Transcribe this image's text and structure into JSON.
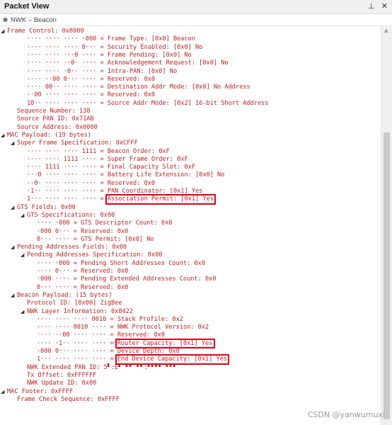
{
  "window": {
    "title": "Packet View",
    "pin_glyph": "1",
    "close_glyph": "✕",
    "subtab": "NWK – Beacon"
  },
  "tree": [
    {
      "indent": 0,
      "expander": "open",
      "text": "Frame Control: 0x8000"
    },
    {
      "indent": 2,
      "expander": "none",
      "text": "···· ···· ···· ·000 = Frame Type: [0x0] Beacon"
    },
    {
      "indent": 2,
      "expander": "none",
      "text": "···· ···· ···· 0··· = Security Enabled: [0x0] No"
    },
    {
      "indent": 2,
      "expander": "none",
      "text": "···· ···· ···0 ···· = Frame Pending: [0x0] No"
    },
    {
      "indent": 2,
      "expander": "none",
      "text": "···· ···· ··0· ···· = Acknowledgement Request: [0x0] No"
    },
    {
      "indent": 2,
      "expander": "none",
      "text": "···· ···· ·0·· ···· = Intra-PAN: [0x0] No"
    },
    {
      "indent": 2,
      "expander": "none",
      "text": "···· ··00 0··· ···· = Reserved: 0x0"
    },
    {
      "indent": 2,
      "expander": "none",
      "text": "···· 00·· ···· ···· = Destination Addr Mode: [0x0] No Address"
    },
    {
      "indent": 2,
      "expander": "none",
      "text": "··00 ···· ···· ···· = Reserved: 0x0"
    },
    {
      "indent": 2,
      "expander": "none",
      "text": "10·· ···· ···· ···· = Source Addr Mode: [0x2] 16-bit Short Address"
    },
    {
      "indent": 1,
      "expander": "none",
      "text": "Sequence Number: 138"
    },
    {
      "indent": 1,
      "expander": "none",
      "text": "Source PAN ID: 0x71AB"
    },
    {
      "indent": 1,
      "expander": "none",
      "text": "Source Address: 0x0000"
    },
    {
      "indent": 0,
      "expander": "open",
      "text": "MAC Payload: (19 bytes)"
    },
    {
      "indent": 1,
      "expander": "open",
      "text": "Super Frame Specification: 0xCFFF"
    },
    {
      "indent": 2,
      "expander": "none",
      "text": "···· ···· ···· 1111 = Beacon Order: 0xF"
    },
    {
      "indent": 2,
      "expander": "none",
      "text": "···· ···· 1111 ···· = Super Frame Order: 0xF"
    },
    {
      "indent": 2,
      "expander": "none",
      "text": "···· 1111 ···· ···· = Final Capacity Slot: 0xF"
    },
    {
      "indent": 2,
      "expander": "none",
      "text": "···0 ···· ···· ···· = Battery Life Extension: [0x0] No"
    },
    {
      "indent": 2,
      "expander": "none",
      "text": "··0· ···· ···· ···· = Reserved: 0x0"
    },
    {
      "indent": 2,
      "expander": "none",
      "text": "·1·· ···· ···· ···· = PAN Coordinator: [0x1] Yes"
    },
    {
      "indent": 2,
      "expander": "none",
      "text": "1··· ···· ···· ···· = Association Permit: [0x1] Yes"
    },
    {
      "indent": 1,
      "expander": "open",
      "text": "GTS Fields: 0x00"
    },
    {
      "indent": 2,
      "expander": "open",
      "text": "GTS Specifications: 0x00"
    },
    {
      "indent": 3,
      "expander": "none",
      "text": "···· ·000 = GTS Descriptor Count: 0x0"
    },
    {
      "indent": 3,
      "expander": "none",
      "text": "·000 0··· = Reserved: 0x0"
    },
    {
      "indent": 3,
      "expander": "none",
      "text": "0··· ···· = GTS Permit: [0x0] No"
    },
    {
      "indent": 1,
      "expander": "open",
      "text": "Pending Addresses Fields: 0x00"
    },
    {
      "indent": 2,
      "expander": "open",
      "text": "Pending Addresses Specification: 0x00"
    },
    {
      "indent": 3,
      "expander": "none",
      "text": "···· ·000 = Pending Short Addresses Count: 0x0"
    },
    {
      "indent": 3,
      "expander": "none",
      "text": "···· 0··· = Reserved: 0x0"
    },
    {
      "indent": 3,
      "expander": "none",
      "text": "·000 ···· = Pending Extended Addresses Count: 0x0"
    },
    {
      "indent": 3,
      "expander": "none",
      "text": "0··· ···· = Reserved: 0x0"
    },
    {
      "indent": 1,
      "expander": "open",
      "text": "Beacon Payload: (15 bytes)"
    },
    {
      "indent": 2,
      "expander": "none",
      "text": "Protocol ID: [0x00] ZigBee"
    },
    {
      "indent": 2,
      "expander": "open",
      "text": "NWK Layer Information: 0x8422"
    },
    {
      "indent": 3,
      "expander": "none",
      "text": "···· ···· ···· 0010 = Stack Profile: 0x2"
    },
    {
      "indent": 3,
      "expander": "none",
      "text": "···· ···· 0010 ···· = NWK Protocol Version: 0x2"
    },
    {
      "indent": 3,
      "expander": "none",
      "text": "···· ··00 ···· ···· = Reserved: 0x0"
    },
    {
      "indent": 3,
      "expander": "none",
      "text": "···· ·1·· ···· ···· = Router Capacity: [0x1] Yes"
    },
    {
      "indent": 3,
      "expander": "none",
      "text": "·000 0··· ···· ···· = Device Depth: 0x0"
    },
    {
      "indent": 3,
      "expander": "none",
      "text": "1··· ···· ···· ···· = End Device Capacity: [0x1] Yes"
    },
    {
      "indent": 2,
      "expander": "none",
      "text": "NWK Extended PAN ID: 5▘:E▘ ▘▘ ▘▘:▘▘▘▘ ▘▘▘"
    },
    {
      "indent": 2,
      "expander": "none",
      "text": "Tx Offset: 0xFFFFFF"
    },
    {
      "indent": 2,
      "expander": "none",
      "text": "NWK Update ID: 0x00"
    },
    {
      "indent": 0,
      "expander": "open",
      "text": "MAC Footer: 0xFFFF"
    },
    {
      "indent": 1,
      "expander": "none",
      "text": "Frame Check Sequence: 0xFFFF"
    }
  ],
  "highlights": [
    21,
    39,
    41
  ],
  "watermark": "CSDN @yanwumuxi"
}
